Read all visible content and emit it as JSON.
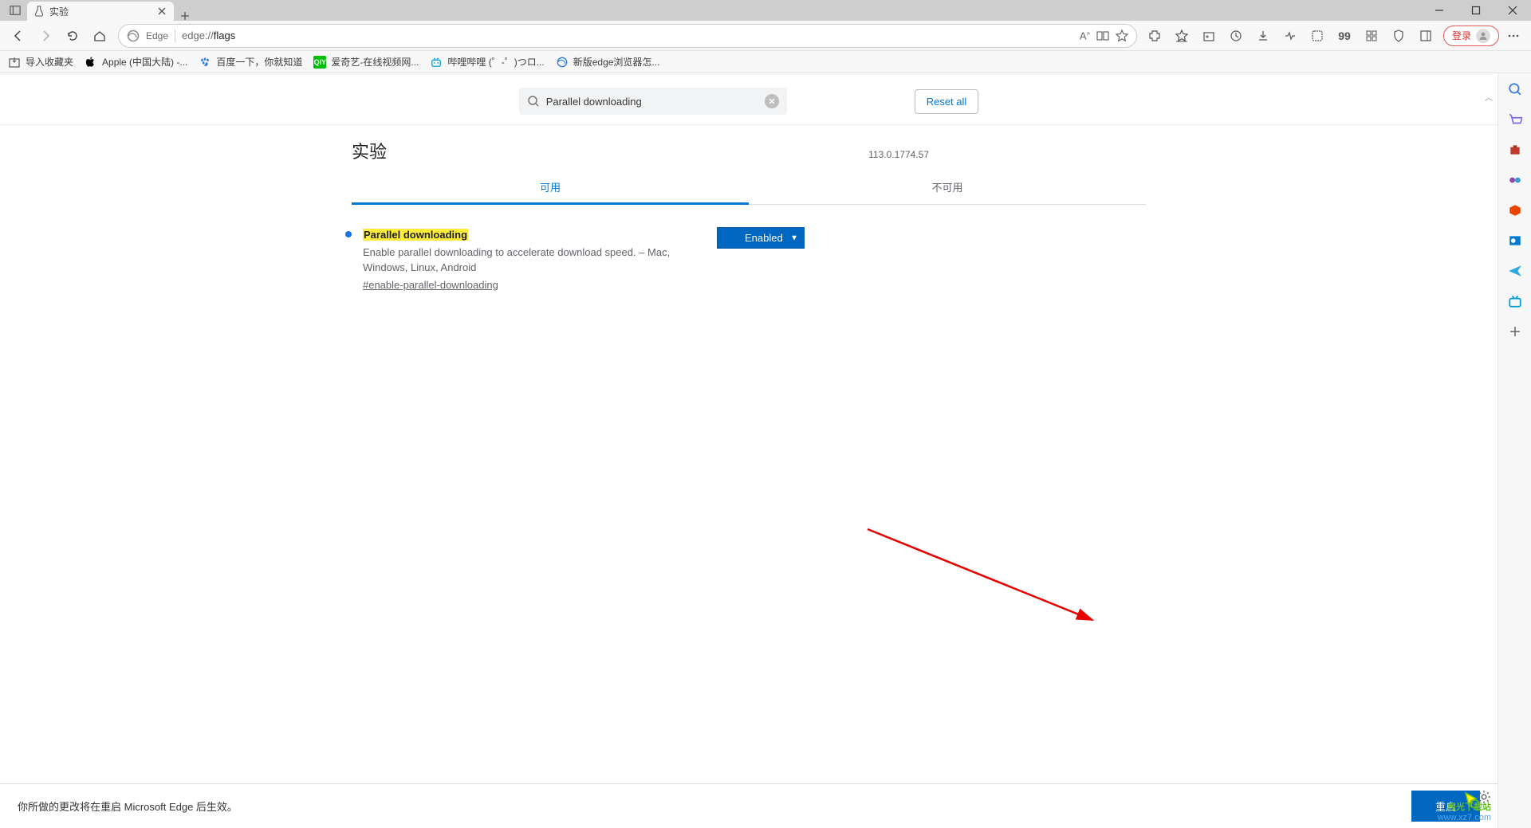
{
  "window": {
    "tab_title": "实验",
    "minimize": "–",
    "maximize": "❐",
    "close": "✕"
  },
  "toolbar": {
    "edge_label": "Edge",
    "url_prefix": "edge://",
    "url_suffix": "flags",
    "login_label": "登录"
  },
  "bookmarks": {
    "import": "导入收藏夹",
    "items": [
      {
        "label": "Apple (中国大陆) -...",
        "color": "#000"
      },
      {
        "label": "百度一下，你就知道",
        "color": "#2f7be4"
      },
      {
        "label": "爱奇艺-在线视频网...",
        "color": "#00be06"
      },
      {
        "label": "哔哩哔哩 (゜-゜)つロ...",
        "color": "#00a1d6"
      },
      {
        "label": "新版edge浏览器怎...",
        "color": "#2f7be4"
      }
    ]
  },
  "flags": {
    "search_value": "Parallel downloading",
    "reset_label": "Reset all",
    "page_title": "实验",
    "version": "113.0.1774.57",
    "tab_available": "可用",
    "tab_unavailable": "不可用",
    "entry": {
      "name": "Parallel downloading",
      "desc": "Enable parallel downloading to accelerate download speed. – Mac, Windows, Linux, Android",
      "hash": "#enable-parallel-downloading",
      "state": "Enabled"
    }
  },
  "banner": {
    "message": "你所做的更改将在重启 Microsoft Edge 后生效。",
    "restart_label": "重启"
  },
  "watermark": {
    "line1": "极光下载站",
    "line2": "www.xz7.com"
  }
}
